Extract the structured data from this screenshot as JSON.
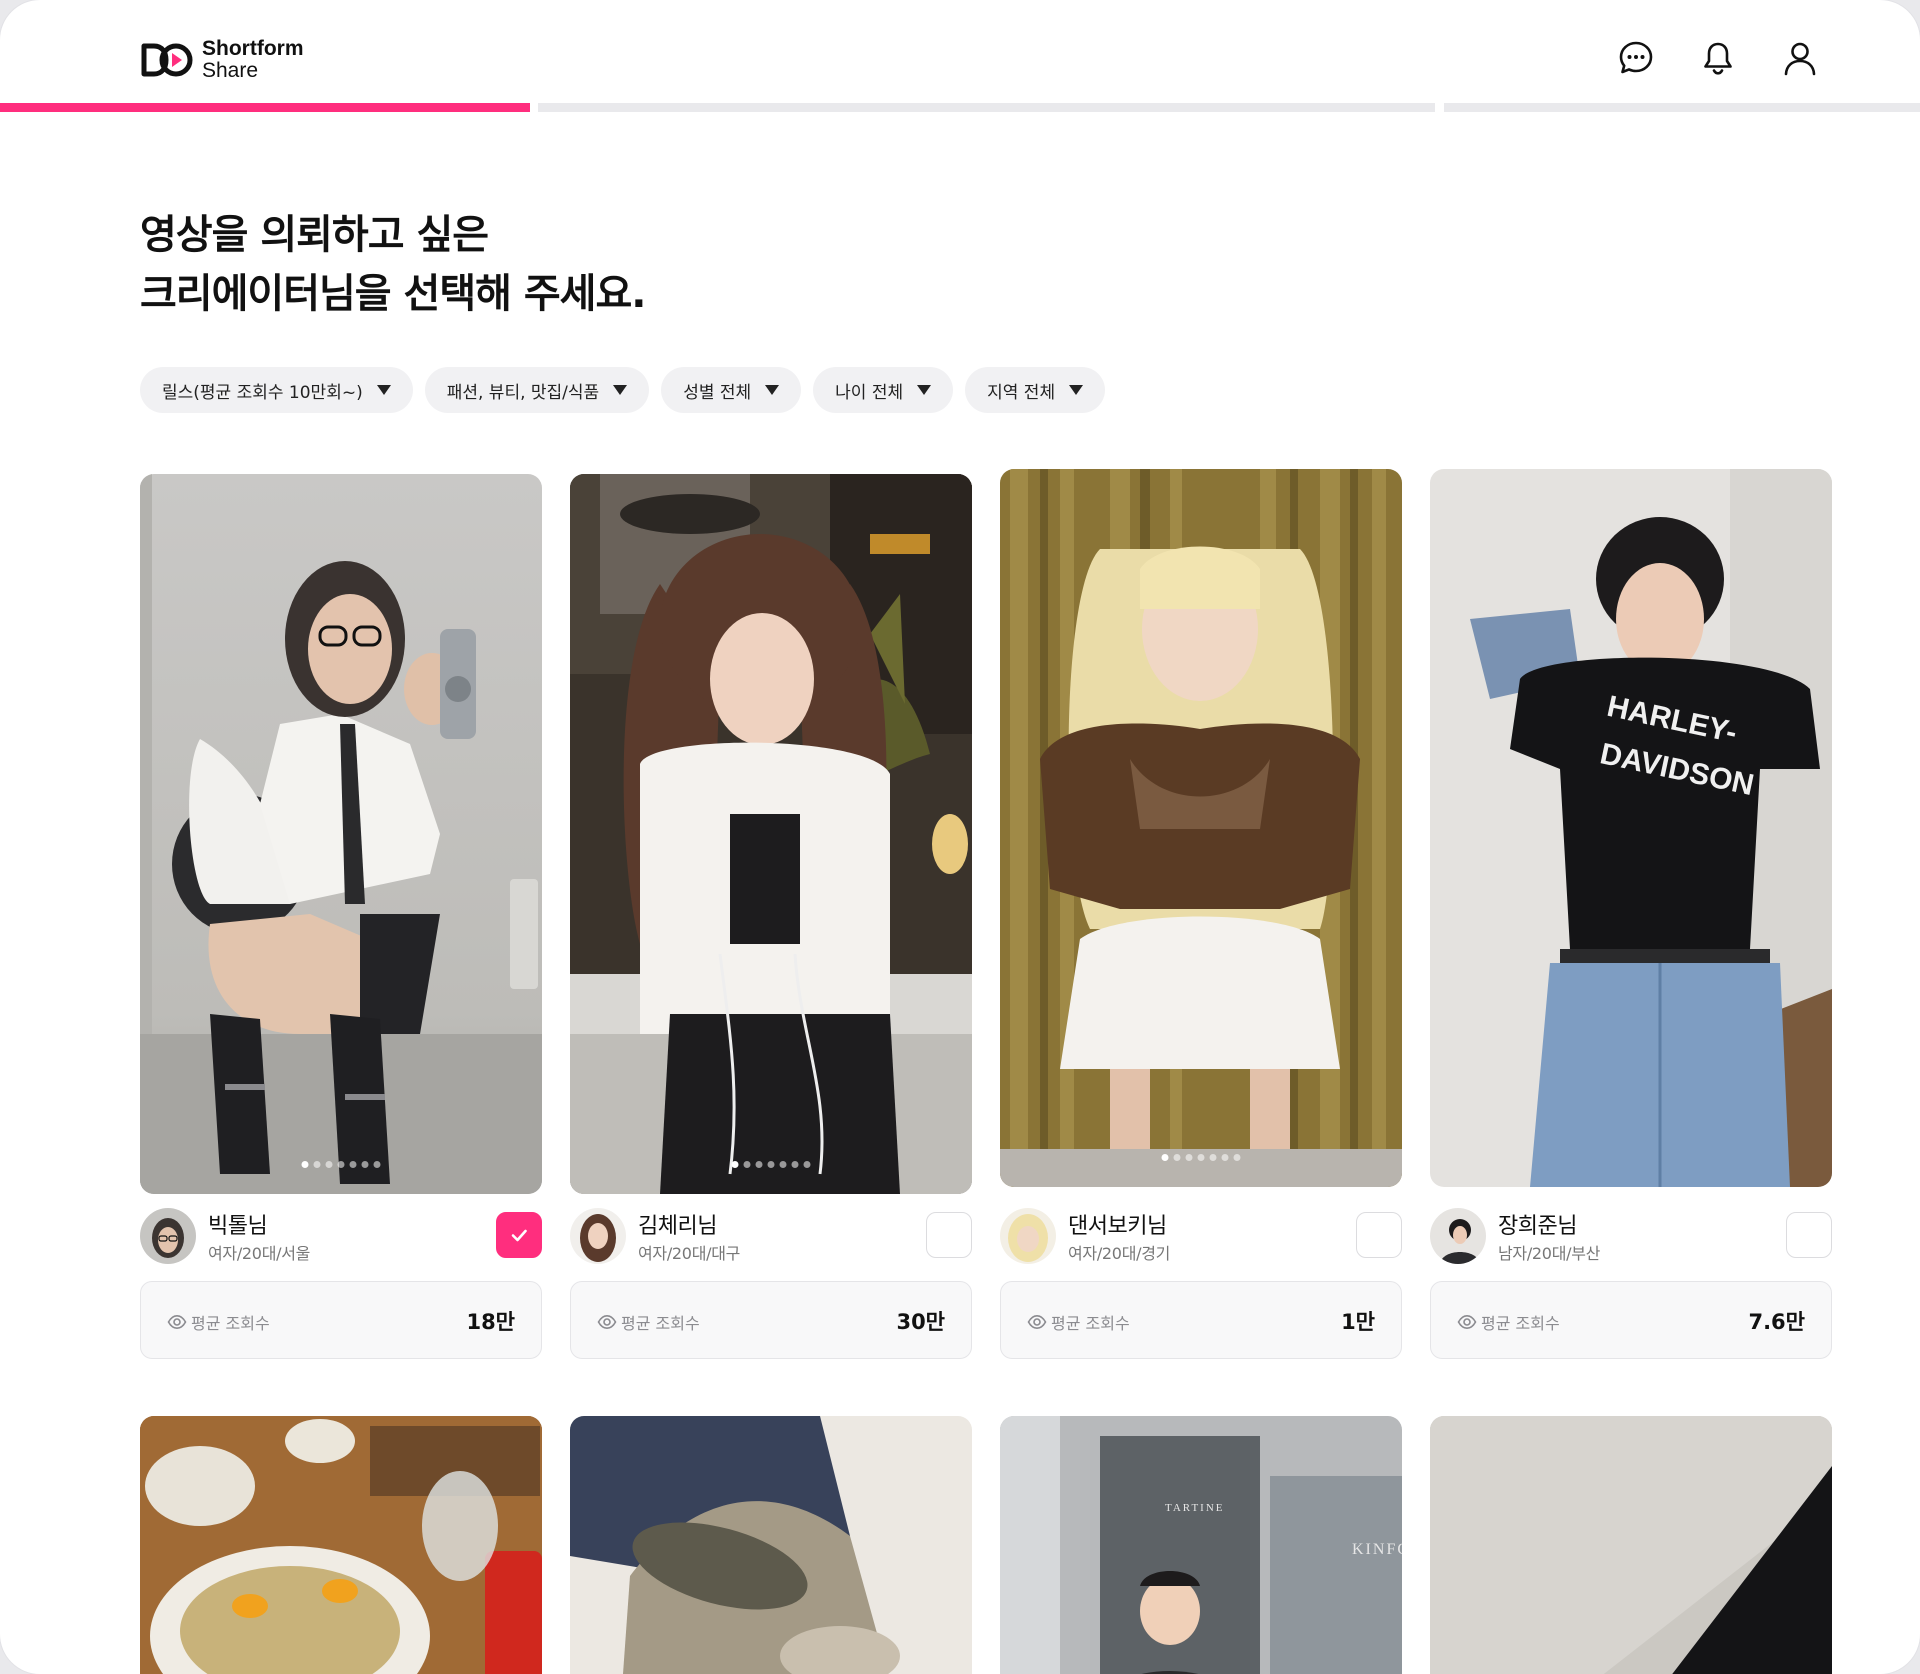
{
  "brand": {
    "line1": "Shortform",
    "line2": "Share",
    "accent": "#ff2e7e"
  },
  "header_icons": [
    "chat-icon",
    "bell-icon",
    "user-icon"
  ],
  "progress": {
    "steps": 3,
    "current": 1
  },
  "title": {
    "line1": "영상을 의뢰하고 싶은",
    "line2": "크리에이터님을 선택해 주세요."
  },
  "filters": [
    {
      "label": "릴스(평균 조회수 10만회~)"
    },
    {
      "label": "패션, 뷰티, 맛집/식품"
    },
    {
      "label": "성별 전체"
    },
    {
      "label": "나이 전체"
    },
    {
      "label": "지역 전체"
    }
  ],
  "views_label": "평균 조회수",
  "creators": [
    {
      "name": "빅톨님",
      "meta": "여자/20대/서울",
      "views": "18만",
      "selected": true
    },
    {
      "name": "김체리님",
      "meta": "여자/20대/대구",
      "views": "30만",
      "selected": false
    },
    {
      "name": "댄서보키님",
      "meta": "여자/20대/경기",
      "views": "1만",
      "selected": false
    },
    {
      "name": "장희준님",
      "meta": "남자/20대/부산",
      "views": "7.6만",
      "selected": false
    }
  ],
  "photo_text": {
    "shirt_line1": "HARLEY-",
    "shirt_line2": "DAVIDSON",
    "store_sign": "TARTINE",
    "store_sign2": "KINFO"
  }
}
